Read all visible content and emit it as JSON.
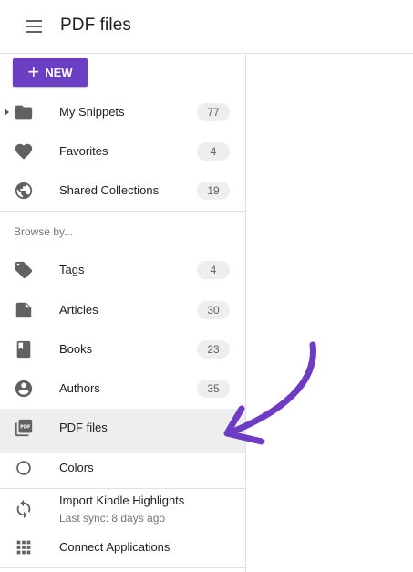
{
  "header": {
    "title": "PDF files"
  },
  "sidebar": {
    "new_button_label": "NEW",
    "top_items": [
      {
        "label": "My Snippets",
        "count": "77",
        "icon": "folder-icon"
      },
      {
        "label": "Favorites",
        "count": "4",
        "icon": "heart-icon"
      },
      {
        "label": "Shared Collections",
        "count": "19",
        "icon": "globe-icon"
      }
    ],
    "browse_label": "Browse by...",
    "browse_items": [
      {
        "label": "Tags",
        "count": "4",
        "icon": "tag-icon"
      },
      {
        "label": "Articles",
        "count": "30",
        "icon": "article-icon"
      },
      {
        "label": "Books",
        "count": "23",
        "icon": "book-icon"
      },
      {
        "label": "Authors",
        "count": "35",
        "icon": "account-circle-icon"
      },
      {
        "label": "PDF files",
        "count": "",
        "icon": "pdf-icon",
        "active": true
      },
      {
        "label": "Colors",
        "count": "",
        "icon": "contrast-icon"
      }
    ],
    "kindle": {
      "label": "Import Kindle Highlights",
      "sub": "Last sync: 8 days ago",
      "icon": "sync-icon"
    },
    "connect": {
      "label": "Connect Applications",
      "icon": "apps-grid-icon"
    }
  },
  "colors": {
    "accent": "#6b3fc4",
    "annotation_arrow": "#6e3cc2",
    "active_bg": "#eeeeee",
    "icon": "#616161"
  }
}
